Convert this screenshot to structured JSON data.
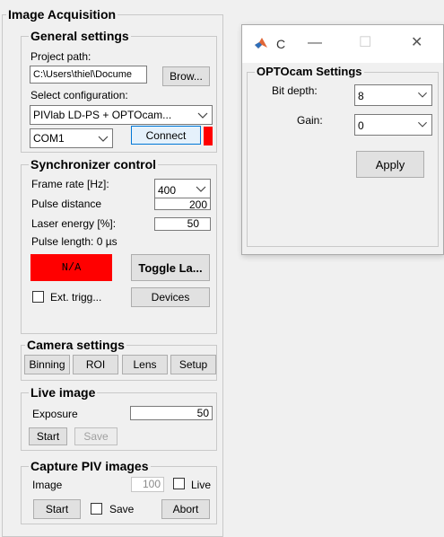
{
  "main": {
    "title": "Image Acquisition",
    "general": {
      "title": "General settings",
      "project_path_label": "Project path:",
      "project_path_value": "C:\\Users\\thiel\\Docume",
      "browse_button": "Brow...",
      "select_config_label": "Select configuration:",
      "config_value": "PIVlab LD-PS + OPTOcam...",
      "com_value": "COM1",
      "connect_button": "Connect",
      "status_color": "#ff0000"
    },
    "sync": {
      "title": "Synchronizer control",
      "frame_rate_label": "Frame rate [Hz]:",
      "frame_rate_value": "400",
      "pulse_distance_label": "Pulse distance",
      "pulse_distance_value": "200",
      "laser_energy_label": "Laser energy [%]:",
      "laser_energy_value": "50",
      "pulse_length_label": "Pulse length: 0 µs",
      "status_text": "N/A",
      "status_color": "#ff0000",
      "toggle_button": "Toggle La...",
      "ext_trigger_label": "Ext. trigg...",
      "devices_button": "Devices"
    },
    "camera": {
      "title": "Camera settings",
      "binning_button": "Binning",
      "roi_button": "ROI",
      "lens_button": "Lens",
      "setup_button": "Setup"
    },
    "live": {
      "title": "Live image",
      "exposure_label": "Exposure",
      "exposure_value": "50",
      "start_button": "Start",
      "save_button": "Save"
    },
    "capture": {
      "title": "Capture PIV images",
      "image_label": "Image",
      "image_value": "100",
      "live_label": "Live",
      "start_button": "Start",
      "save_label": "Save",
      "abort_button": "Abort"
    }
  },
  "dialog": {
    "title": "C",
    "panel_title": "OPTOcam Settings",
    "bit_depth_label": "Bit depth:",
    "bit_depth_value": "8",
    "gain_label": "Gain:",
    "gain_value": "0",
    "apply_button": "Apply"
  },
  "icons": {
    "app_icon": "matlab-icon",
    "dropdown": "chevron-down-icon"
  }
}
